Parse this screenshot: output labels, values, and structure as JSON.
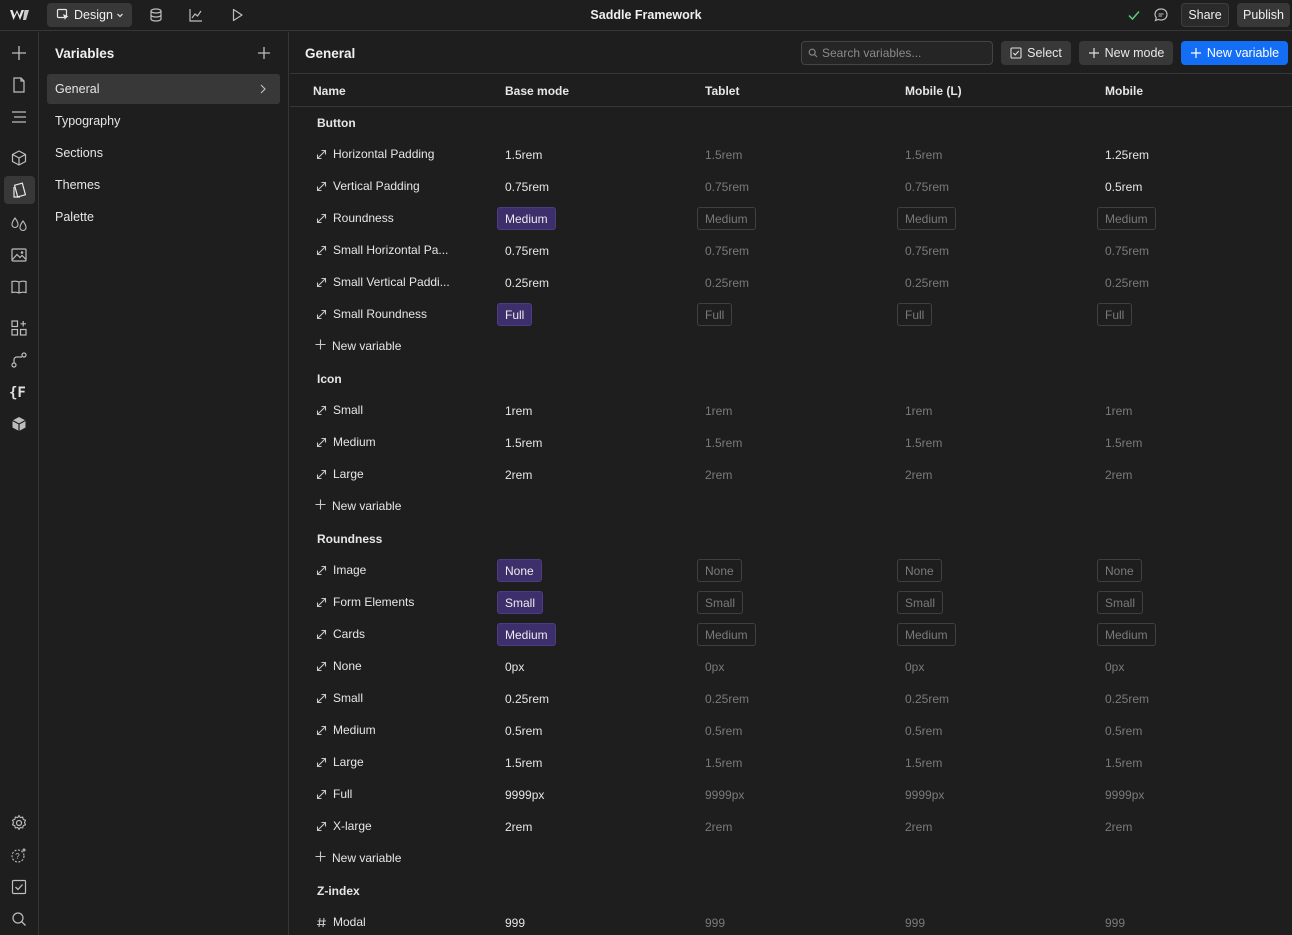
{
  "app": {
    "title": "Saddle Framework",
    "mode_label": "Design",
    "share_label": "Share",
    "publish_label": "Publish"
  },
  "variables_panel": {
    "title": "Variables",
    "collections": [
      {
        "label": "General",
        "active": true
      },
      {
        "label": "Typography"
      },
      {
        "label": "Sections"
      },
      {
        "label": "Themes"
      },
      {
        "label": "Palette"
      }
    ]
  },
  "main": {
    "title": "General",
    "search_placeholder": "Search variables...",
    "select_label": "Select",
    "new_mode_label": "New mode",
    "new_variable_label": "New variable",
    "columns": [
      "Name",
      "Base mode",
      "Tablet",
      "Mobile (L)",
      "Mobile"
    ],
    "new_variable_row_label": "New variable",
    "groups": [
      {
        "label": "Button",
        "rows": [
          {
            "name": "Horizontal Padding",
            "type": "size",
            "values": [
              "1.5rem",
              "1.5rem",
              "1.5rem",
              "1.25rem"
            ],
            "mob_override": true
          },
          {
            "name": "Vertical Padding",
            "type": "size",
            "values": [
              "0.75rem",
              "0.75rem",
              "0.75rem",
              "0.5rem"
            ],
            "mob_override": true
          },
          {
            "name": "Roundness",
            "type": "size",
            "pill": true,
            "values": [
              "Medium",
              "Medium",
              "Medium",
              "Medium"
            ]
          },
          {
            "name": "Small Horizontal Pa...",
            "type": "size",
            "values": [
              "0.75rem",
              "0.75rem",
              "0.75rem",
              "0.75rem"
            ]
          },
          {
            "name": "Small Vertical Paddi...",
            "type": "size",
            "values": [
              "0.25rem",
              "0.25rem",
              "0.25rem",
              "0.25rem"
            ]
          },
          {
            "name": "Small Roundness",
            "type": "size",
            "pill": true,
            "values": [
              "Full",
              "Full",
              "Full",
              "Full"
            ]
          }
        ]
      },
      {
        "label": "Icon",
        "rows": [
          {
            "name": "Small",
            "type": "size",
            "values": [
              "1rem",
              "1rem",
              "1rem",
              "1rem"
            ]
          },
          {
            "name": "Medium",
            "type": "size",
            "values": [
              "1.5rem",
              "1.5rem",
              "1.5rem",
              "1.5rem"
            ]
          },
          {
            "name": "Large",
            "type": "size",
            "values": [
              "2rem",
              "2rem",
              "2rem",
              "2rem"
            ]
          }
        ]
      },
      {
        "label": "Roundness",
        "rows": [
          {
            "name": "Image",
            "type": "size",
            "pill": true,
            "values": [
              "None",
              "None",
              "None",
              "None"
            ]
          },
          {
            "name": "Form Elements",
            "type": "size",
            "pill": true,
            "values": [
              "Small",
              "Small",
              "Small",
              "Small"
            ]
          },
          {
            "name": "Cards",
            "type": "size",
            "pill": true,
            "values": [
              "Medium",
              "Medium",
              "Medium",
              "Medium"
            ]
          },
          {
            "name": "None",
            "type": "size",
            "values": [
              "0px",
              "0px",
              "0px",
              "0px"
            ]
          },
          {
            "name": "Small",
            "type": "size",
            "values": [
              "0.25rem",
              "0.25rem",
              "0.25rem",
              "0.25rem"
            ]
          },
          {
            "name": "Medium",
            "type": "size",
            "values": [
              "0.5rem",
              "0.5rem",
              "0.5rem",
              "0.5rem"
            ]
          },
          {
            "name": "Large",
            "type": "size",
            "values": [
              "1.5rem",
              "1.5rem",
              "1.5rem",
              "1.5rem"
            ]
          },
          {
            "name": "Full",
            "type": "size",
            "values": [
              "9999px",
              "9999px",
              "9999px",
              "9999px"
            ]
          },
          {
            "name": "X-large",
            "type": "size",
            "values": [
              "2rem",
              "2rem",
              "2rem",
              "2rem"
            ]
          }
        ]
      },
      {
        "label": "Z-index",
        "no_new_row": true,
        "rows": [
          {
            "name": "Modal",
            "type": "number",
            "values": [
              "999",
              "999",
              "999",
              "999"
            ]
          }
        ]
      }
    ]
  },
  "colors": {
    "accent": "#146ef5",
    "reference_pill": "#3d2f6b",
    "background": "#1e1e1e",
    "check": "#5cc97a"
  }
}
